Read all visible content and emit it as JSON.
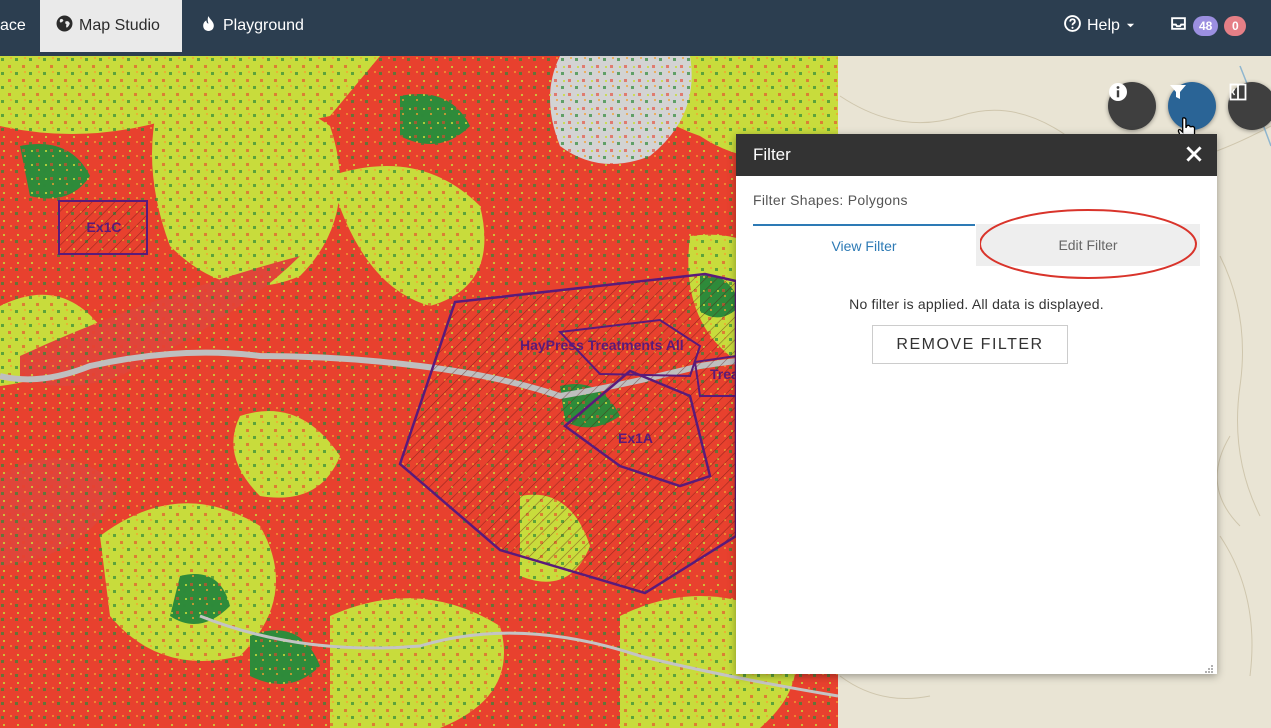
{
  "nav": {
    "partial_item": "ace",
    "map_studio": "Map Studio",
    "playground": "Playground",
    "help": "Help",
    "badge_blue": "48",
    "badge_red": "0"
  },
  "map": {
    "labels": {
      "ex1c": "Ex1C",
      "hay_press": "HayPress Treatments All",
      "ex1a": "Ex1A",
      "trea": "Trea"
    },
    "colors": {
      "high": "#e8412e",
      "moderate": "#c8dc3c",
      "low": "#2e8b3a",
      "polygon_outline": "#5a1a7a",
      "topo_background": "#e9e4d4"
    }
  },
  "panel": {
    "title": "Filter",
    "subtitle": "Filter Shapes: Polygons",
    "tab_view": "View Filter",
    "tab_edit": "Edit Filter",
    "message": "No filter is applied. All data is displayed.",
    "remove_button": "REMOVE FILTER"
  },
  "icons": {
    "map_studio": "globe-icon",
    "playground": "flame-icon",
    "help": "question-circle-icon",
    "inbox": "inbox-icon",
    "info": "info-icon",
    "filter": "filter-icon",
    "split": "split-view-icon",
    "close": "close-icon"
  }
}
